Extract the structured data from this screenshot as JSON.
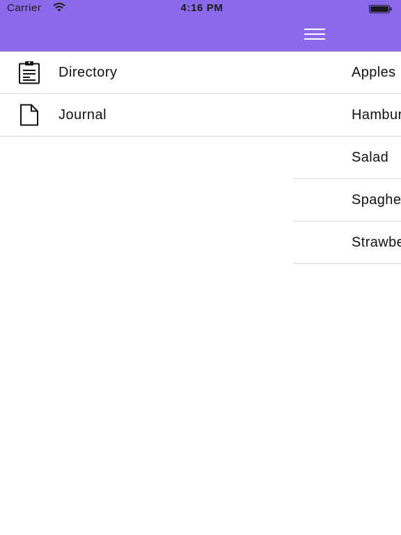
{
  "status_bar": {
    "carrier": "Carrier",
    "time": "4:16 PM",
    "wifi_icon": "wifi-icon",
    "battery_icon": "battery-icon"
  },
  "colors": {
    "header": "#8a6aeb",
    "divider": "#dcdcdc",
    "text": "#111111"
  },
  "drawer": {
    "items": [
      {
        "label": "Directory",
        "icon": "clipboard-icon"
      },
      {
        "label": "Journal",
        "icon": "document-icon"
      }
    ]
  },
  "main": {
    "menu_icon": "hamburger-menu-icon",
    "items": [
      {
        "label": "Apples"
      },
      {
        "label": "Hamburger"
      },
      {
        "label": "Salad"
      },
      {
        "label": "Spaghetti"
      },
      {
        "label": "Strawberries"
      }
    ]
  }
}
